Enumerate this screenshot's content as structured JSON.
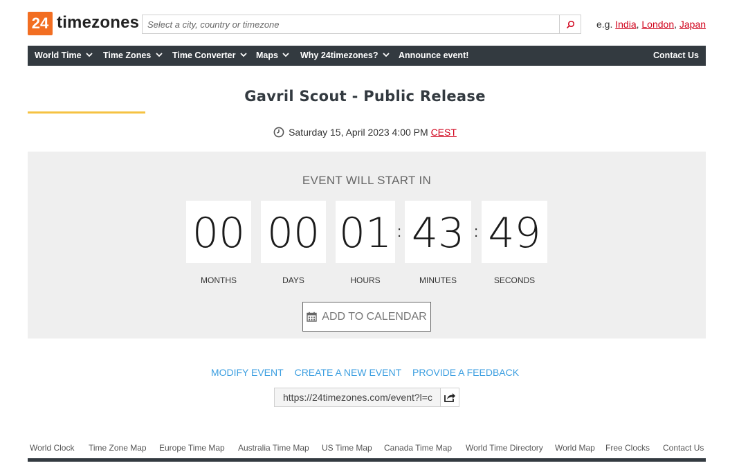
{
  "header": {
    "logo_number": "24",
    "logo_text": "timezones",
    "search_placeholder": "Select a city, country or timezone",
    "examples_prefix": "e.g.",
    "examples": [
      "India",
      "London",
      "Japan"
    ]
  },
  "nav": {
    "items": [
      {
        "label": "World Time",
        "dropdown": true
      },
      {
        "label": "Time Zones",
        "dropdown": true
      },
      {
        "label": "Time Converter",
        "dropdown": true
      },
      {
        "label": "Maps",
        "dropdown": true
      },
      {
        "label": "Why 24timezones?",
        "dropdown": true
      },
      {
        "label": "Announce event!",
        "dropdown": false
      }
    ],
    "contact": "Contact Us"
  },
  "event": {
    "title": "Gavril Scout - Public Release",
    "datetime": "Saturday 15, April 2023 4:00 PM",
    "timezone": "CEST",
    "starts_label": "EVENT WILL START IN",
    "countdown": {
      "months": "00",
      "days": "00",
      "hours": "01",
      "minutes": "43",
      "seconds": "49"
    },
    "labels": {
      "months": "MONTHS",
      "days": "DAYS",
      "hours": "HOURS",
      "minutes": "MINUTES",
      "seconds": "SECONDS"
    },
    "add_to_calendar": "ADD TO CALENDAR"
  },
  "actions": {
    "modify": "MODIFY EVENT",
    "create": "CREATE A NEW EVENT",
    "feedback": "PROVIDE A FEEDBACK"
  },
  "share": {
    "url": "https://24timezones.com/event?l=c"
  },
  "footer": {
    "links": [
      "World Clock",
      "Time Zone Map",
      "Europe Time Map",
      "Australia Time Map",
      "US Time Map",
      "Canada Time Map",
      "World Time Directory",
      "World Map",
      "Free Clocks",
      "Contact Us"
    ]
  },
  "colors": {
    "brand_orange": "#f26e22",
    "nav_bg": "#333a40",
    "accent_yellow": "#f5c242",
    "link_red": "#d0021b",
    "link_blue": "#3b9ee0",
    "panel_bg": "#efefef"
  },
  "icons": {
    "search": "search-icon",
    "clock": "clock-icon",
    "calendar": "calendar-icon",
    "share": "share-icon",
    "chevron": "chevron-down-icon"
  }
}
